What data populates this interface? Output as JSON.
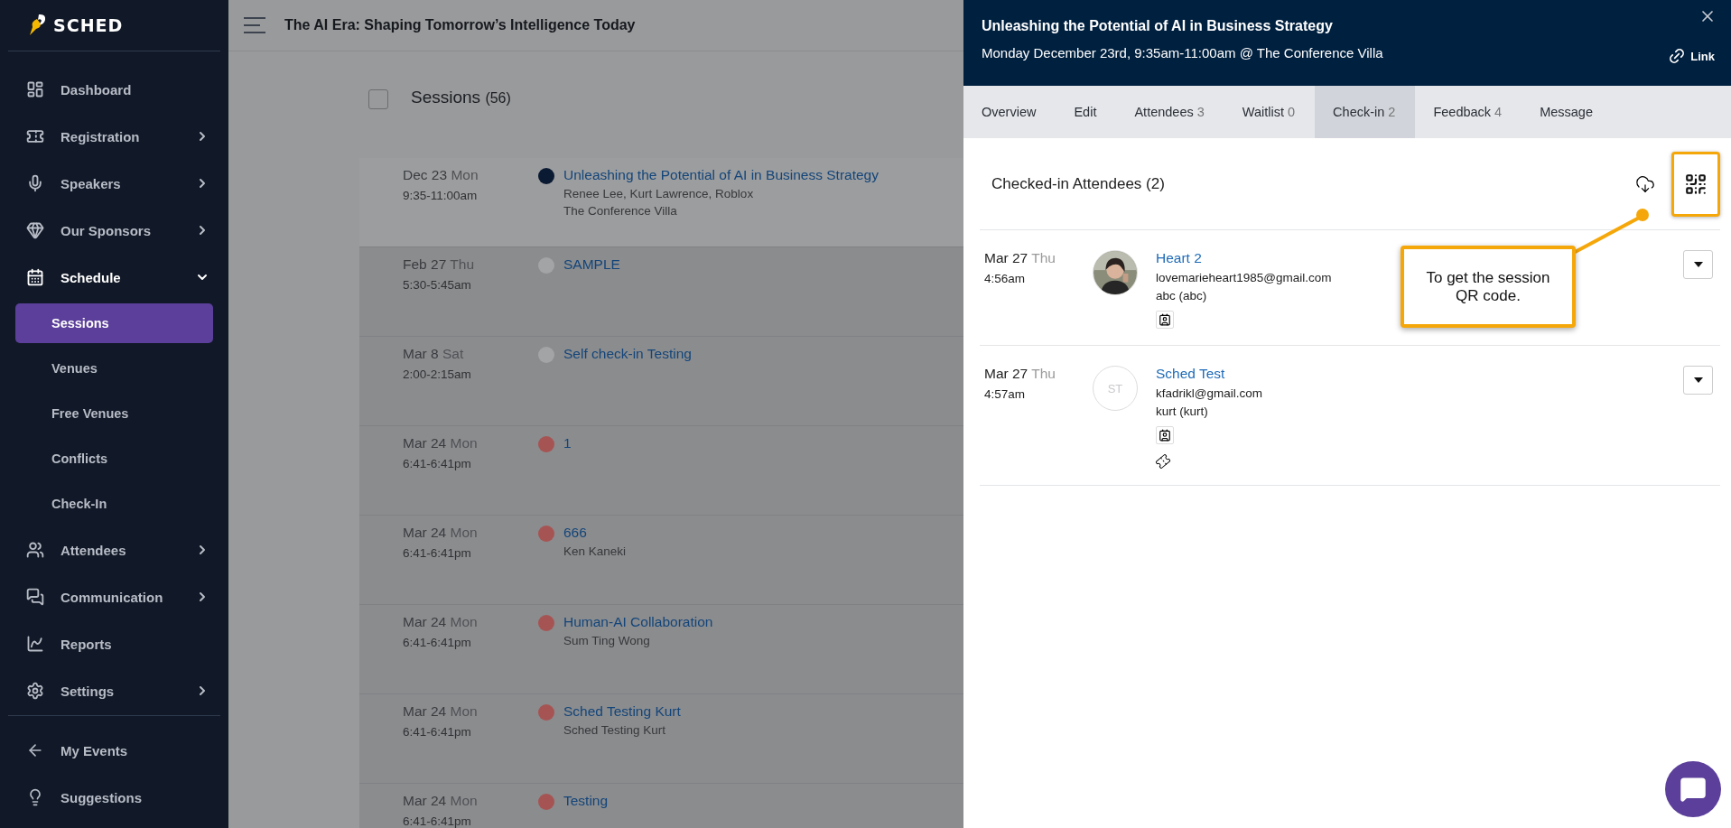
{
  "logo": "SCHED",
  "sidebar": {
    "items": [
      {
        "label": "Dashboard",
        "expandable": false,
        "expanded": false
      },
      {
        "label": "Registration",
        "expandable": true,
        "expanded": false
      },
      {
        "label": "Speakers",
        "expandable": true,
        "expanded": false
      },
      {
        "label": "Our Sponsors",
        "expandable": true,
        "expanded": false
      },
      {
        "label": "Schedule",
        "expandable": true,
        "expanded": true,
        "children": [
          {
            "label": "Sessions",
            "selected": true
          },
          {
            "label": "Venues",
            "selected": false
          },
          {
            "label": "Free Venues",
            "selected": false
          },
          {
            "label": "Conflicts",
            "selected": false
          },
          {
            "label": "Check-In",
            "selected": false
          }
        ]
      },
      {
        "label": "Attendees",
        "expandable": true,
        "expanded": false
      },
      {
        "label": "Communication",
        "expandable": true,
        "expanded": false
      },
      {
        "label": "Reports",
        "expandable": false,
        "expanded": false
      },
      {
        "label": "Settings",
        "expandable": true,
        "expanded": false
      }
    ],
    "footer_items": [
      {
        "label": "My Events"
      },
      {
        "label": "Suggestions"
      }
    ]
  },
  "event_title": "The AI Era: Shaping Tomorrow’s Intelligence Today",
  "sessions": {
    "title": "Sessions",
    "count": "(56)",
    "all_checked": false,
    "rows": [
      {
        "date": "Dec 23",
        "day": "Mon",
        "time": "9:35-11:00am",
        "color": "#0b1a33",
        "title": "Unleashing the Potential of AI in Business Strategy",
        "lines": [
          "Renee Lee, Kurt Lawrence, Roblox",
          "The Conference Villa"
        ],
        "selected": true
      },
      {
        "date": "Feb 27",
        "day": "Thu",
        "time": "5:30-5:45am",
        "color": "#a3a4a6",
        "title": "SAMPLE",
        "lines": [],
        "selected": false
      },
      {
        "date": "Mar 8",
        "day": "Sat",
        "time": "2:00-2:15am",
        "color": "#a3a4a6",
        "title": "Self check-in Testing",
        "lines": [],
        "selected": false
      },
      {
        "date": "Mar 24",
        "day": "Mon",
        "time": "6:41-6:41pm",
        "color": "#a65453",
        "title": "1",
        "lines": [],
        "selected": false
      },
      {
        "date": "Mar 24",
        "day": "Mon",
        "time": "6:41-6:41pm",
        "color": "#a65453",
        "title": "666",
        "lines": [
          "Ken Kaneki"
        ],
        "selected": false
      },
      {
        "date": "Mar 24",
        "day": "Mon",
        "time": "6:41-6:41pm",
        "color": "#a65453",
        "title": "Human-AI Collaboration",
        "lines": [
          "Sum Ting Wong"
        ],
        "selected": false
      },
      {
        "date": "Mar 24",
        "day": "Mon",
        "time": "6:41-6:41pm",
        "color": "#a65453",
        "title": "Sched Testing Kurt",
        "lines": [
          "Sched Testing Kurt"
        ],
        "selected": false
      },
      {
        "date": "Mar 24",
        "day": "Mon",
        "time": "6:41-6:41pm",
        "color": "#a65453",
        "title": "Testing",
        "lines": [],
        "selected": false
      }
    ]
  },
  "panel": {
    "title": "Unleashing the Potential of AI in Business Strategy",
    "subtitle": "Monday December 23rd, 9:35am-11:00am @ The Conference Villa",
    "link_label": "Link",
    "tabs": [
      {
        "label": "Overview",
        "selected": false
      },
      {
        "label": "Edit",
        "selected": false
      },
      {
        "label": "Attendees",
        "count": "3",
        "selected": false
      },
      {
        "label": "Waitlist",
        "count": "0",
        "selected": false
      },
      {
        "label": "Check-in",
        "count": "2",
        "selected": true
      },
      {
        "label": "Feedback",
        "count": "4",
        "selected": false
      },
      {
        "label": "Message",
        "selected": false
      }
    ],
    "section_title": "Checked-in Attendees (2)",
    "qr_highlighted": true,
    "attendees": [
      {
        "date": "Mar 27",
        "day": "Thu",
        "time": "4:56am",
        "name": "Heart 2",
        "email": "lovemarieheart1985@gmail.com",
        "ticket": "abc (abc)",
        "ticket_icon": false
      },
      {
        "date": "Mar 27",
        "day": "Thu",
        "time": "4:57am",
        "avatar": {
          "kind": "initials",
          "text": "ST"
        },
        "name": "Sched Test",
        "email": "kfadrikl@gmail.com",
        "ticket": "kurt (kurt)",
        "ticket_icon": true
      }
    ],
    "callout": {
      "text": "To get the session QR code."
    }
  }
}
